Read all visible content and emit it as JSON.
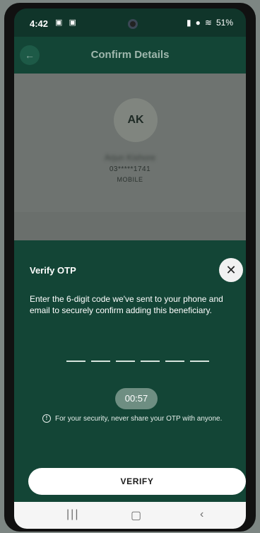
{
  "status": {
    "time": "4:42",
    "left_icons": "▣ ▣",
    "battery": "51%"
  },
  "appbar": {
    "title": "Confirm Details"
  },
  "beneficiary": {
    "initials": "AK",
    "name": "Arjun Kishore",
    "number": "03*****1741",
    "type": "MOBILE"
  },
  "otp": {
    "heading": "Verify OTP",
    "description": "Enter the 6-digit code we've sent to your phone and email to securely confirm adding this beneficiary.",
    "digits": [
      "",
      "",
      "",
      "",
      "",
      ""
    ],
    "timer": "00:57",
    "notice": "For your security, never share your OTP with anyone.",
    "verify_label": "VERIFY"
  },
  "icons": {
    "back": "arrow-left-icon",
    "close": "close-icon",
    "info": "info-icon",
    "recents": "recents-icon",
    "home": "home-icon",
    "nav_back": "chevron-left-icon"
  },
  "colors": {
    "brand_dark": "#134536",
    "sheet": "#134536",
    "timer": "#6e8e82"
  }
}
